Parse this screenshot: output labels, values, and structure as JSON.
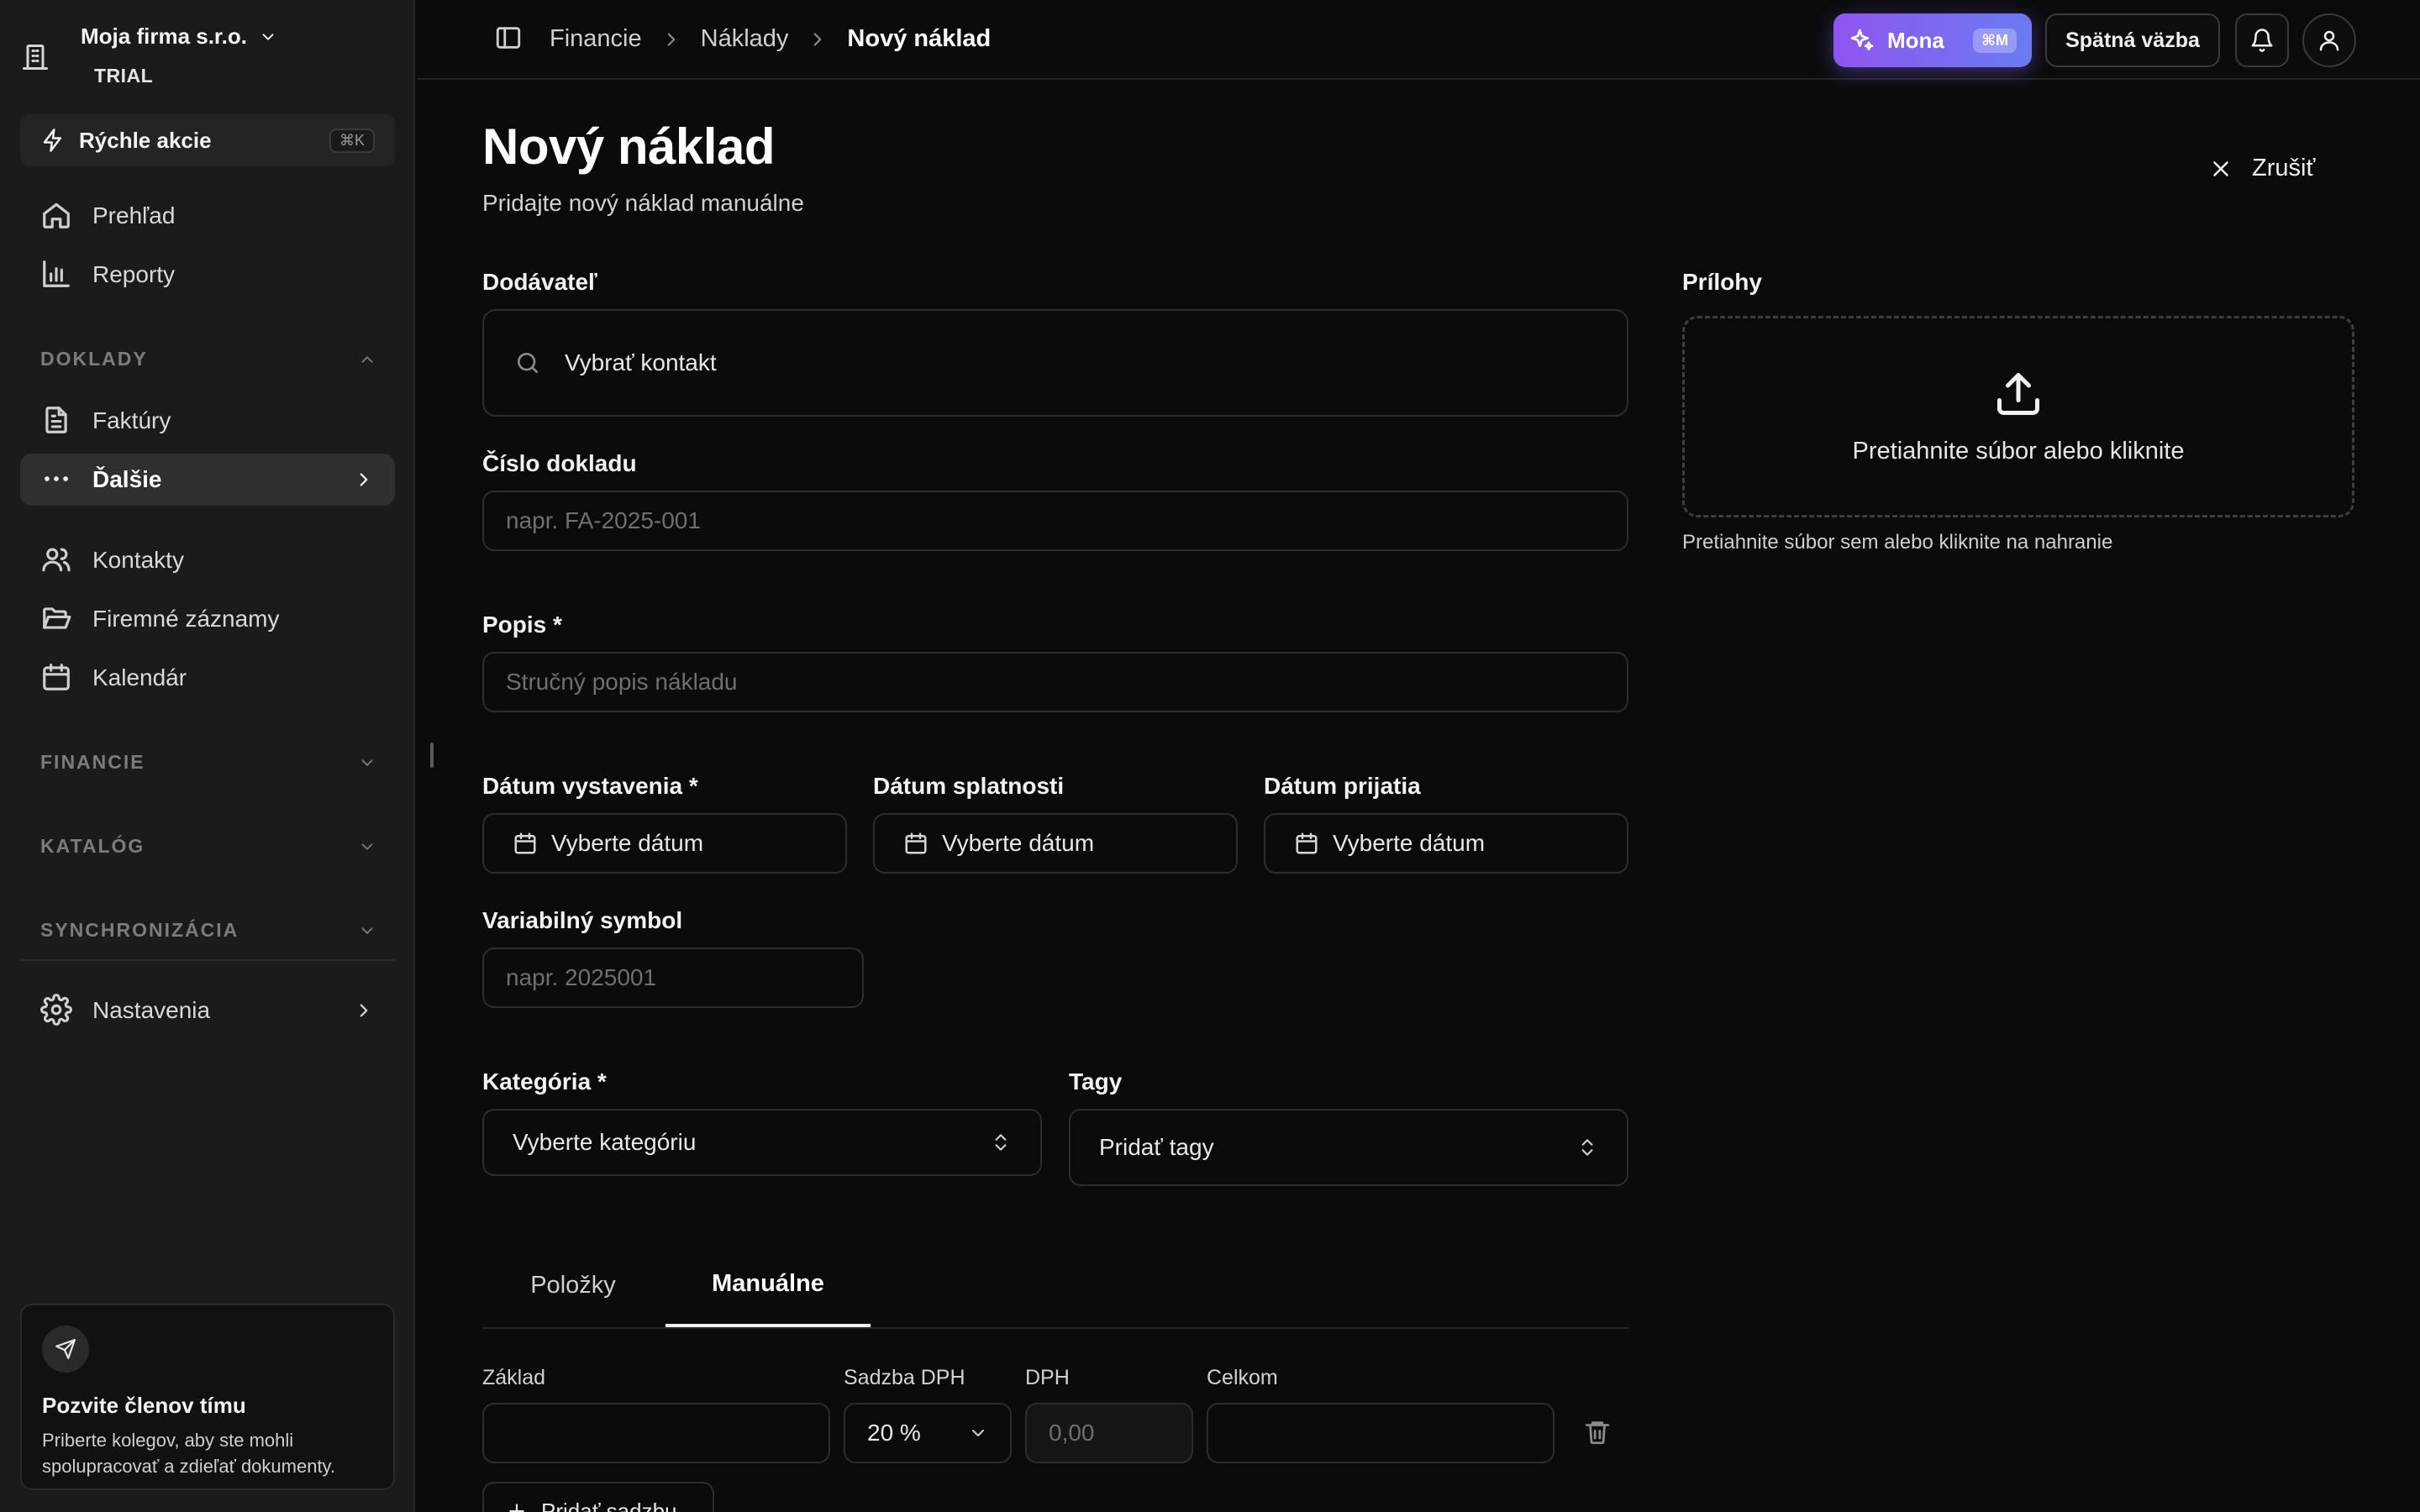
{
  "sidebar": {
    "org_name": "Moja firma s.r.o.",
    "org_plan": "TRIAL",
    "quick_actions": {
      "label": "Rýchle akcie",
      "shortcut": "⌘K"
    },
    "items": {
      "overview": "Prehľad",
      "reports": "Reporty",
      "invoices": "Faktúry",
      "more": "Ďalšie",
      "contacts": "Kontakty",
      "records": "Firemné záznamy",
      "calendar": "Kalendár",
      "settings": "Nastavenia"
    },
    "sections": {
      "documents": "DOKLADY",
      "finance": "FINANCIE",
      "catalog": "KATALÓG",
      "sync": "SYNCHRONIZÁCIA"
    },
    "invite": {
      "title": "Pozvite členov tímu",
      "text": "Priberte kolegov, aby ste mohli spolupracovať a zdieľať dokumenty."
    }
  },
  "topbar": {
    "breadcrumb": [
      "Financie",
      "Náklady",
      "Nový náklad"
    ],
    "mona_label": "Mona",
    "mona_shortcut": "⌘M",
    "feedback_label": "Spätná väzba"
  },
  "page": {
    "title": "Nový náklad",
    "subtitle": "Pridajte nový náklad manuálne",
    "cancel_label": "Zrušiť"
  },
  "form": {
    "supplier": {
      "label": "Dodávateľ",
      "placeholder": "Vybrať kontakt"
    },
    "doc_number": {
      "label": "Číslo dokladu",
      "placeholder": "napr. FA-2025-001"
    },
    "description": {
      "label": "Popis *",
      "placeholder": "Stručný popis nákladu"
    },
    "issue_date": {
      "label": "Dátum vystavenia *",
      "placeholder": "Vyberte dátum"
    },
    "due_date": {
      "label": "Dátum splatnosti",
      "placeholder": "Vyberte dátum"
    },
    "received_date": {
      "label": "Dátum prijatia",
      "placeholder": "Vyberte dátum"
    },
    "variable_symbol": {
      "label": "Variabilný symbol",
      "placeholder": "napr. 2025001"
    },
    "category": {
      "label": "Kategória *",
      "value": "Vyberte kategóriu"
    },
    "tags": {
      "label": "Tagy",
      "value": "Pridať tagy"
    }
  },
  "attachments": {
    "label": "Prílohy",
    "drop_text": "Pretiahnite súbor alebo kliknite",
    "hint": "Pretiahnite súbor sem alebo kliknite na nahranie"
  },
  "tabs": [
    "Položky",
    "Manuálne"
  ],
  "manual": {
    "base_label": "Základ",
    "vat_rate_label": "Sadzba DPH",
    "vat_rate_value": "20 %",
    "vat_label": "DPH",
    "vat_placeholder": "0,00",
    "total_label": "Celkom",
    "add_rate_label": "Pridať sadzbu"
  }
}
